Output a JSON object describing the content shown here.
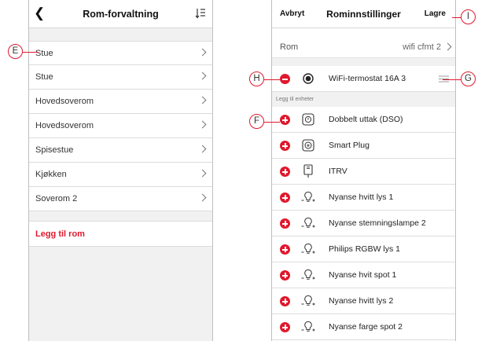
{
  "left_screen": {
    "back_icon": "chevron-left-icon",
    "title": "Rom-forvaltning",
    "sort_icon": "sort-list-icon",
    "rooms": [
      {
        "label": "Stue"
      },
      {
        "label": "Stue"
      },
      {
        "label": "Hovedsoverom"
      },
      {
        "label": "Hovedsoverom"
      },
      {
        "label": "Spisestue"
      },
      {
        "label": "Kjøkken"
      },
      {
        "label": "Soverom 2"
      }
    ],
    "add_room_label": "Legg til rom"
  },
  "right_screen": {
    "cancel_label": "Avbryt",
    "title": "Rominnstillinger",
    "save_label": "Lagre",
    "room_field": {
      "label": "Rom",
      "value": "wifi cfmt 2"
    },
    "assigned_devices": [
      {
        "name": "WiFi-termostat 16A 3",
        "icon": "thermostat-icon"
      }
    ],
    "section_label": "Legg til enheter",
    "available_devices": [
      {
        "name": "Dobbelt uttak (DSO)",
        "icon": "socket-icon"
      },
      {
        "name": "Smart Plug",
        "icon": "plug-icon"
      },
      {
        "name": "ITRV",
        "icon": "valve-icon"
      },
      {
        "name": "Nyanse hvitt lys 1",
        "icon": "bulb-icon"
      },
      {
        "name": "Nyanse stemningslampe 2",
        "icon": "bulb-icon"
      },
      {
        "name": "Philips RGBW lys 1",
        "icon": "bulb-icon"
      },
      {
        "name": "Nyanse hvit spot 1",
        "icon": "bulb-icon"
      },
      {
        "name": "Nyanse hvitt lys 2",
        "icon": "bulb-icon"
      },
      {
        "name": "Nyanse farge spot 2",
        "icon": "bulb-icon"
      }
    ]
  },
  "callouts": {
    "E": "E",
    "F": "F",
    "G": "G",
    "H": "H",
    "I": "I"
  },
  "colors": {
    "accent_red": "#e0182d",
    "background_gray": "#f1f1f1",
    "divider": "#dcdcdc"
  }
}
